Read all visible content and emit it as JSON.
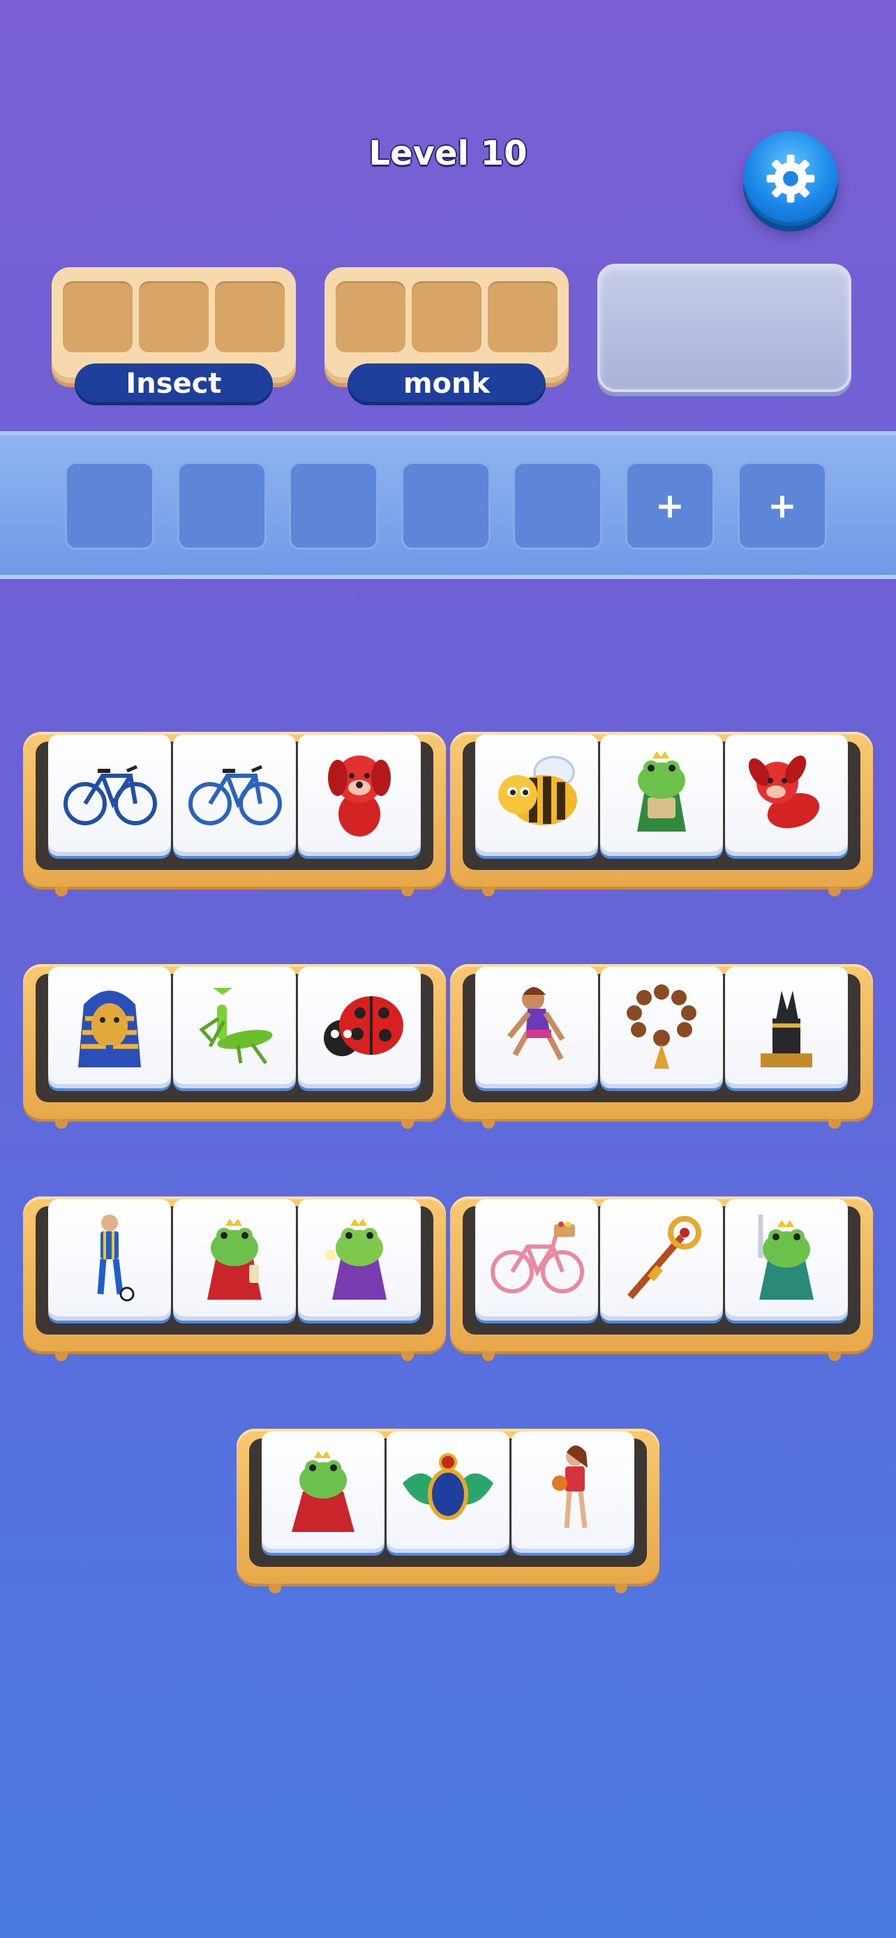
{
  "header": {
    "level_title": "Level 10"
  },
  "categories": [
    {
      "label": "Insect",
      "slots": 3
    },
    {
      "label": "monk",
      "slots": 3
    }
  ],
  "tray": {
    "plus_symbol": "+"
  },
  "shelves": [
    {
      "tiles": [
        "blue-road-bicycle",
        "blue-road-bicycle",
        "red-puppy"
      ]
    },
    {
      "tiles": [
        "cartoon-bee",
        "frog-scholar",
        "red-puppy-jumping"
      ]
    },
    {
      "tiles": [
        "pharaoh-mask",
        "praying-mantis",
        "ladybug"
      ]
    },
    {
      "tiles": [
        "girl-sprinter",
        "prayer-beads",
        "anubis-statue"
      ]
    },
    {
      "tiles": [
        "soccer-player",
        "frog-king-scroll",
        "frog-king-flower"
      ]
    },
    {
      "tiles": [
        "pink-bicycle",
        "golden-scepter",
        "frog-knight-sword"
      ]
    },
    {
      "tiles": [
        "frog-king-red-cape",
        "scarab-amulet",
        "basketball-girl"
      ]
    }
  ],
  "colors": {
    "bg_top": "#7a5fd4",
    "bg_bottom": "#4a7adf",
    "label_pill": "#1e3f9c",
    "shelf_wood": "#f0b75a",
    "tray": "#7fa6ec"
  }
}
